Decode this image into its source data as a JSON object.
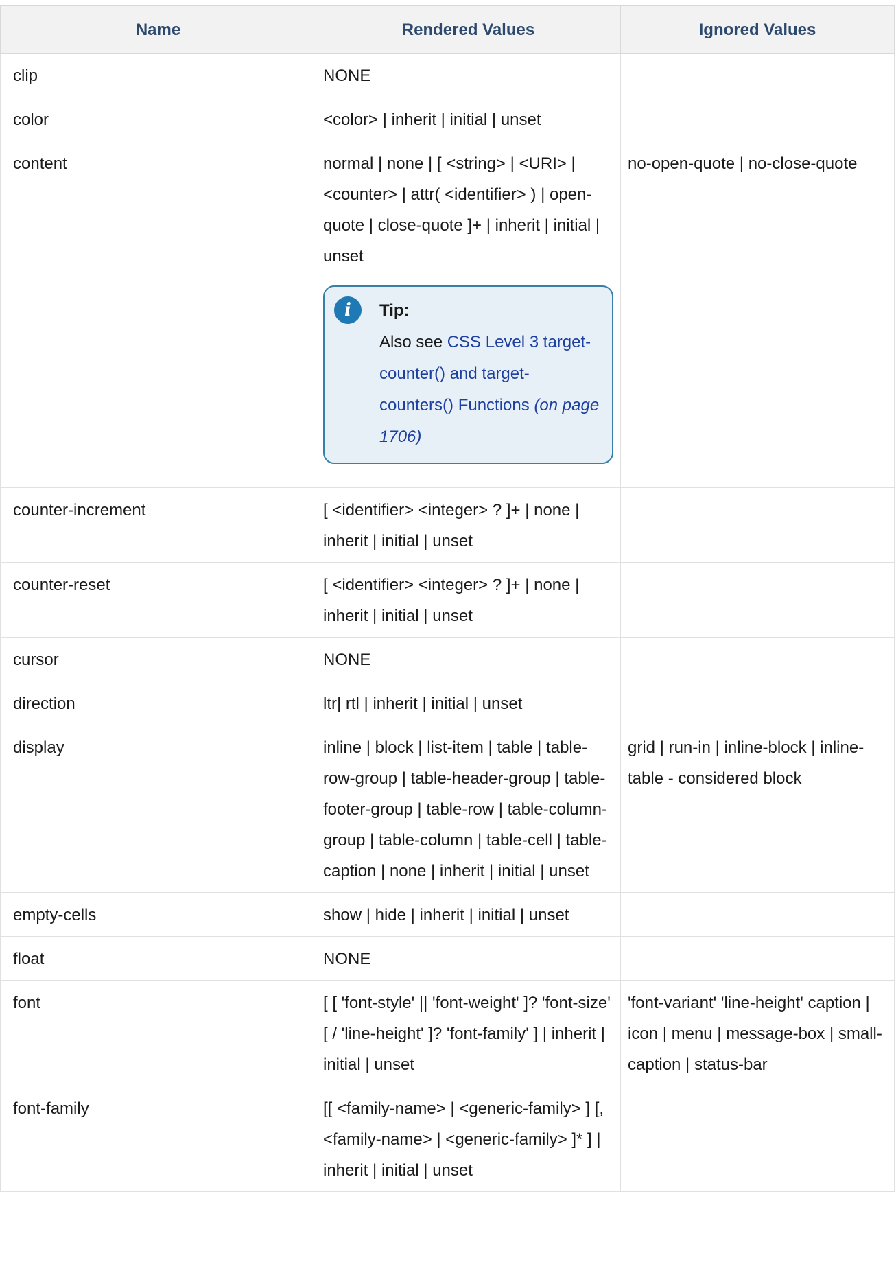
{
  "table": {
    "headers": [
      "Name",
      "Rendered Values",
      "Ignored Values"
    ],
    "rows": [
      {
        "name": "clip",
        "rendered": "NONE",
        "ignored": ""
      },
      {
        "name": "color",
        "rendered": "<color> | inherit | initial | unset",
        "ignored": ""
      },
      {
        "name": "content",
        "rendered": "normal | none | [ <string> | <URI> | <counter> | attr( <identifier> ) | open-quote | close-quote ]+ | inherit | initial | unset",
        "ignored": "no-open-quote | no-close-quote"
      },
      {
        "name": "counter-increment",
        "rendered": "[ <identifier> <integer> ? ]+ | none | inherit | initial | unset",
        "ignored": ""
      },
      {
        "name": "counter-reset",
        "rendered": "[ <identifier> <integer> ? ]+ | none | inherit | initial | unset",
        "ignored": ""
      },
      {
        "name": "cursor",
        "rendered": "NONE",
        "ignored": ""
      },
      {
        "name": "direction",
        "rendered": "ltr| rtl | inherit | initial | unset",
        "ignored": ""
      },
      {
        "name": "display",
        "rendered": "inline | block | list-item | table | table-row-group | table-header-group | table-footer-group | table-row | table-column-group | table-column | table-cell | table-caption | none | inherit | initial | unset",
        "ignored": "grid | run-in | inline-block | inline-table - considered block"
      },
      {
        "name": "empty-cells",
        "rendered": "show | hide | inherit | initial | unset",
        "ignored": ""
      },
      {
        "name": "float",
        "rendered": "NONE",
        "ignored": ""
      },
      {
        "name": "font",
        "rendered": "[ [ 'font-style' || 'font-weight' ]? 'font-size' [ / 'line-height' ]? 'font-family' ] | inherit | initial | unset",
        "ignored": "'font-variant' 'line-height' caption | icon | menu | message-box | small-caption | status-bar"
      },
      {
        "name": "font-family",
        "rendered": "[[ <family-name> | <generic-family> ] [, <family-name> | <generic-family> ]* ] | inherit | initial | unset",
        "ignored": ""
      }
    ]
  },
  "tip": {
    "label": "Tip:",
    "prefix": "Also see ",
    "link_text": "CSS Level 3 target-counter() and target-counters() Functions",
    "page_ref": "(on page 1706)",
    "icon": "info-icon"
  },
  "colors": {
    "header_text": "#2d4a6e",
    "header_bg": "#f2f2f2",
    "tip_bg": "#e6f0f6",
    "tip_border": "#3a7fa8",
    "link": "#1d3fa0"
  }
}
